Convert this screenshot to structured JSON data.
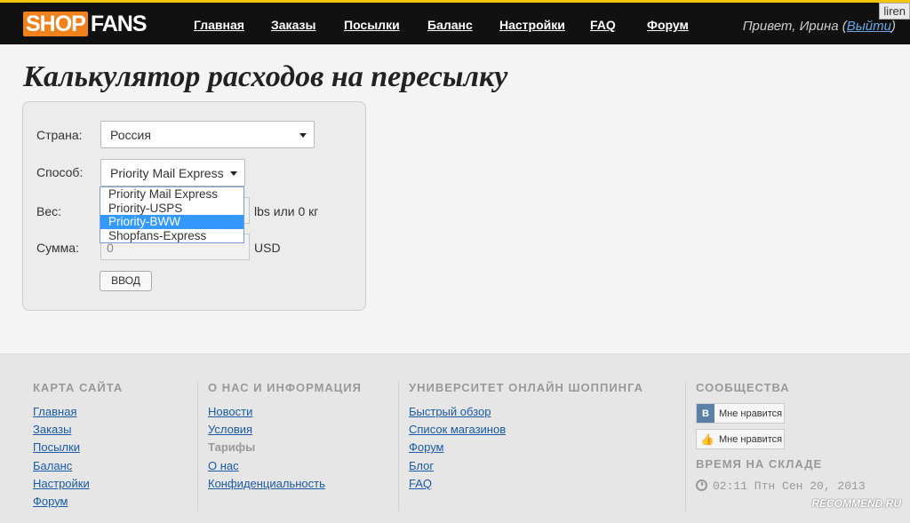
{
  "header": {
    "logo_part1": "SHOP",
    "logo_part2": "FANS",
    "nav": [
      "Главная",
      "Заказы",
      "Посылки",
      "Баланс",
      "Настройки",
      "FAQ",
      "Форум"
    ],
    "greeting_prefix": "Привет, Ирина (",
    "logout_label": "Выйти",
    "greeting_suffix": ")",
    "corner_tag": "liren"
  },
  "page": {
    "title": "Калькулятор расходов на пересылку"
  },
  "calculator": {
    "country_label": "Страна:",
    "country_value": "Россия",
    "method_label": "Способ:",
    "method_value": "Priority Mail Express",
    "method_options": [
      "Priority Mail Express",
      "Priority-USPS",
      "Priority-BWW",
      "Shopfans-Express"
    ],
    "method_highlighted": "Priority-BWW",
    "weight_label": "Вес:",
    "weight_unit": "lbs или 0 кг",
    "sum_label": "Сумма:",
    "sum_value": "0",
    "sum_unit": "USD",
    "submit_label": "ВВОД"
  },
  "footer": {
    "sitemap": {
      "heading": "КАРТА САЙТА",
      "links": [
        "Главная",
        "Заказы",
        "Посылки",
        "Баланс",
        "Настройки",
        "Форум"
      ]
    },
    "about": {
      "heading": "О НАС И ИНФОРМАЦИЯ",
      "links": [
        "Новости",
        "Условия"
      ],
      "static_item": "Тарифы",
      "links_after": [
        "О нас",
        "Конфиденциальность"
      ]
    },
    "university": {
      "heading": "УНИВЕРСИТЕТ ОНЛАЙН ШОППИНГА",
      "links": [
        "Быстрый обзор",
        "Список магазинов",
        "Форум",
        "Блог",
        "FAQ"
      ]
    },
    "communities": {
      "heading": "СООБЩЕСТВА",
      "vk_letter": "В",
      "vk_like": "Мне нравится",
      "fb_like": "Мне нравится"
    },
    "warehouse_time": {
      "heading": "ВРЕМЯ НА СКЛАДЕ",
      "value": "02:11 Птн Сен 20, 2013"
    },
    "watermark": "RECOMMEND.RU"
  },
  "colors": {
    "topbar": "#111111",
    "topbar_accent": "#f5c400",
    "logo_orange": "#f0821e",
    "link": "#1a5aa8",
    "highlight": "#3399ff"
  }
}
